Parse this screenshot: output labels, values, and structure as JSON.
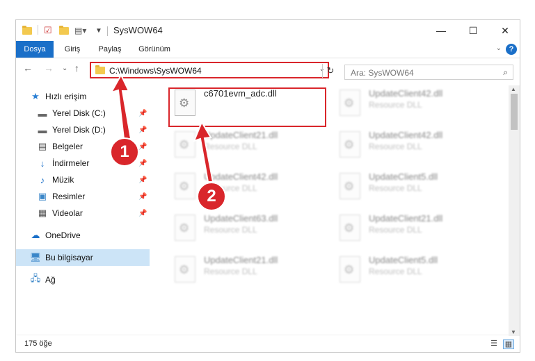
{
  "window": {
    "title": "SysWOW64",
    "controls": {
      "minimize": "—",
      "maximize": "☐",
      "close": "✕"
    }
  },
  "ribbon": {
    "tabs": [
      "Dosya",
      "Giriş",
      "Paylaş",
      "Görünüm"
    ],
    "help": "?"
  },
  "nav": {
    "address": "C:\\Windows\\SysWOW64",
    "search_placeholder": "Ara: SysWOW64"
  },
  "sidebar": {
    "items": [
      {
        "label": "Hızlı erişim",
        "icon": "star-icon"
      },
      {
        "label": "Yerel Disk (C:)",
        "icon": "drive-icon"
      },
      {
        "label": "Yerel Disk (D:)",
        "icon": "drive-icon"
      },
      {
        "label": "Belgeler",
        "icon": "documents-icon"
      },
      {
        "label": "İndirmeler",
        "icon": "download-icon"
      },
      {
        "label": "Müzik",
        "icon": "music-icon"
      },
      {
        "label": "Resimler",
        "icon": "pictures-icon"
      },
      {
        "label": "Videolar",
        "icon": "videos-icon"
      },
      {
        "label": "OneDrive",
        "icon": "cloud-icon"
      },
      {
        "label": "Bu bilgisayar",
        "icon": "computer-icon"
      },
      {
        "label": "Ağ",
        "icon": "network-icon"
      }
    ]
  },
  "files": [
    {
      "name": "c6701evm_adc.dll",
      "type": ""
    },
    {
      "name": "UpdateClient42.dll",
      "type": "Resource DLL"
    },
    {
      "name": "UpdateClient21.dll",
      "type": "Resource DLL"
    },
    {
      "name": "UpdateClient42.dll",
      "type": "Resource DLL"
    },
    {
      "name": "UpdateClient42.dll",
      "type": "Resource DLL"
    },
    {
      "name": "UpdateClient5.dll",
      "type": "Resource DLL"
    },
    {
      "name": "UpdateClient63.dll",
      "type": "Resource DLL"
    },
    {
      "name": "UpdateClient21.dll",
      "type": "Resource DLL"
    },
    {
      "name": "UpdateClient21.dll",
      "type": "Resource DLL"
    },
    {
      "name": "UpdateClient5.dll",
      "type": "Resource DLL"
    }
  ],
  "status": {
    "count": "175 öğe"
  },
  "annotations": {
    "step1": "1",
    "step2": "2",
    "accent": "#d9262b"
  }
}
